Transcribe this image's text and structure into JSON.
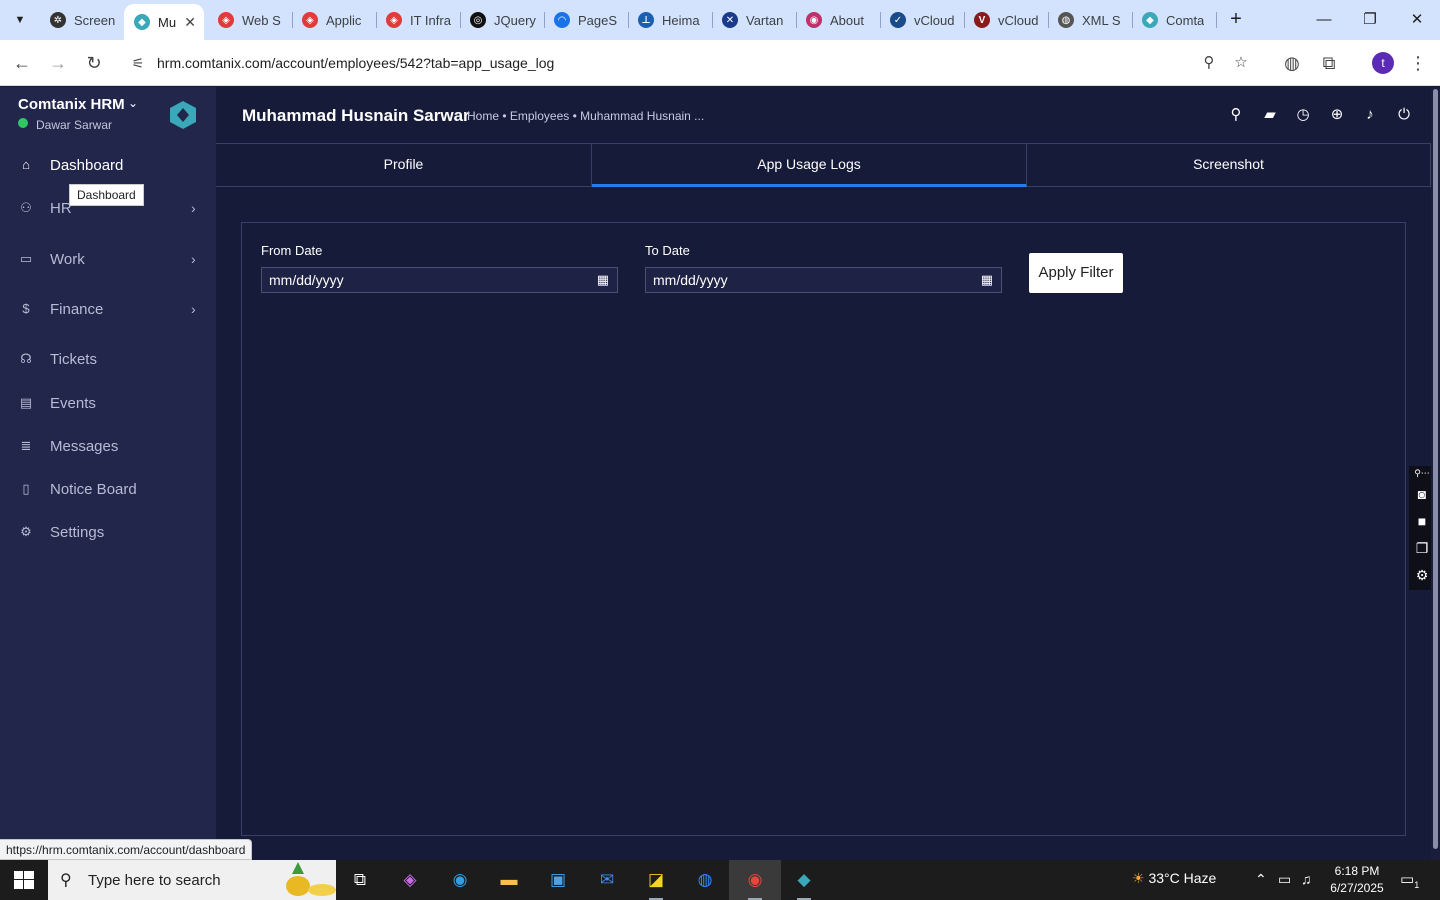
{
  "browser": {
    "tabs": [
      {
        "title": "Screen",
        "fav_color": "#333333",
        "fav_glyph": "✲"
      },
      {
        "title": "Mu",
        "fav_color": "#3aa8b8",
        "fav_glyph": "◆"
      },
      {
        "title": "Web S",
        "fav_color": "#e23b3b",
        "fav_glyph": "◈"
      },
      {
        "title": "Applic",
        "fav_color": "#e23b3b",
        "fav_glyph": "◈"
      },
      {
        "title": "IT Infra",
        "fav_color": "#e23b3b",
        "fav_glyph": "◈"
      },
      {
        "title": "JQuery",
        "fav_color": "#111111",
        "fav_glyph": "◎"
      },
      {
        "title": "PageS",
        "fav_color": "#1a73e8",
        "fav_glyph": "◠"
      },
      {
        "title": "Heima",
        "fav_color": "#1a5fb4",
        "fav_glyph": "⊥"
      },
      {
        "title": "Vartan",
        "fav_color": "#1a3b8a",
        "fav_glyph": "✕"
      },
      {
        "title": "About",
        "fav_color": "#c0306a",
        "fav_glyph": "◉"
      },
      {
        "title": "vCloud",
        "fav_color": "#1a4b8a",
        "fav_glyph": "✓"
      },
      {
        "title": "vCloud",
        "fav_color": "#8b1a1a",
        "fav_glyph": "V"
      },
      {
        "title": "XML S",
        "fav_color": "#555555",
        "fav_glyph": "◍"
      },
      {
        "title": "Comta",
        "fav_color": "#3aa8b8",
        "fav_glyph": "◆"
      }
    ],
    "active_tab_index": 1,
    "url": "hrm.comtanix.com/account/employees/542?tab=app_usage_log",
    "status_url": "https://hrm.comtanix.com/account/dashboard",
    "profile_initial": "t"
  },
  "sidebar": {
    "brand": "Comtanix HRM",
    "user": "Dawar Sarwar",
    "tooltip": "Dashboard",
    "items": [
      {
        "label": "Dashboard",
        "icon": "home-icon",
        "glyph": "⌂",
        "chevron": false,
        "active": true
      },
      {
        "label": "HR",
        "icon": "users-icon",
        "glyph": "⚇",
        "chevron": true,
        "active": false
      },
      {
        "label": "Work",
        "icon": "briefcase-icon",
        "glyph": "▭",
        "chevron": true,
        "active": false
      },
      {
        "label": "Finance",
        "icon": "dollar-icon",
        "glyph": "$",
        "chevron": true,
        "active": false
      },
      {
        "label": "Tickets",
        "icon": "headset-icon",
        "glyph": "☊",
        "chevron": false,
        "active": false
      },
      {
        "label": "Events",
        "icon": "calendar-icon",
        "glyph": "▤",
        "chevron": false,
        "active": false
      },
      {
        "label": "Messages",
        "icon": "message-icon",
        "glyph": "≣",
        "chevron": false,
        "active": false
      },
      {
        "label": "Notice Board",
        "icon": "clipboard-icon",
        "glyph": "▯",
        "chevron": false,
        "active": false
      },
      {
        "label": "Settings",
        "icon": "gear-icon",
        "glyph": "⚙",
        "chevron": false,
        "active": false
      }
    ],
    "chevron_glyph": "›"
  },
  "header": {
    "title": "Muhammad Husnain Sarwar",
    "breadcrumb": "Home • Employees • Muhammad Husnain ..."
  },
  "profile_tabs": [
    "Profile",
    "App Usage Logs",
    "Screenshot"
  ],
  "filter": {
    "from_label": "From Date",
    "to_label": "To Date",
    "from_placeholder": "mm/dd/yyyy",
    "to_placeholder": "mm/dd/yyyy",
    "apply_label": "Apply Filter"
  },
  "taskbar": {
    "search_placeholder": "Type here to search",
    "weather": "33°C  Haze",
    "time": "6:18 PM",
    "date": "6/27/2025",
    "notification_count": "1"
  }
}
